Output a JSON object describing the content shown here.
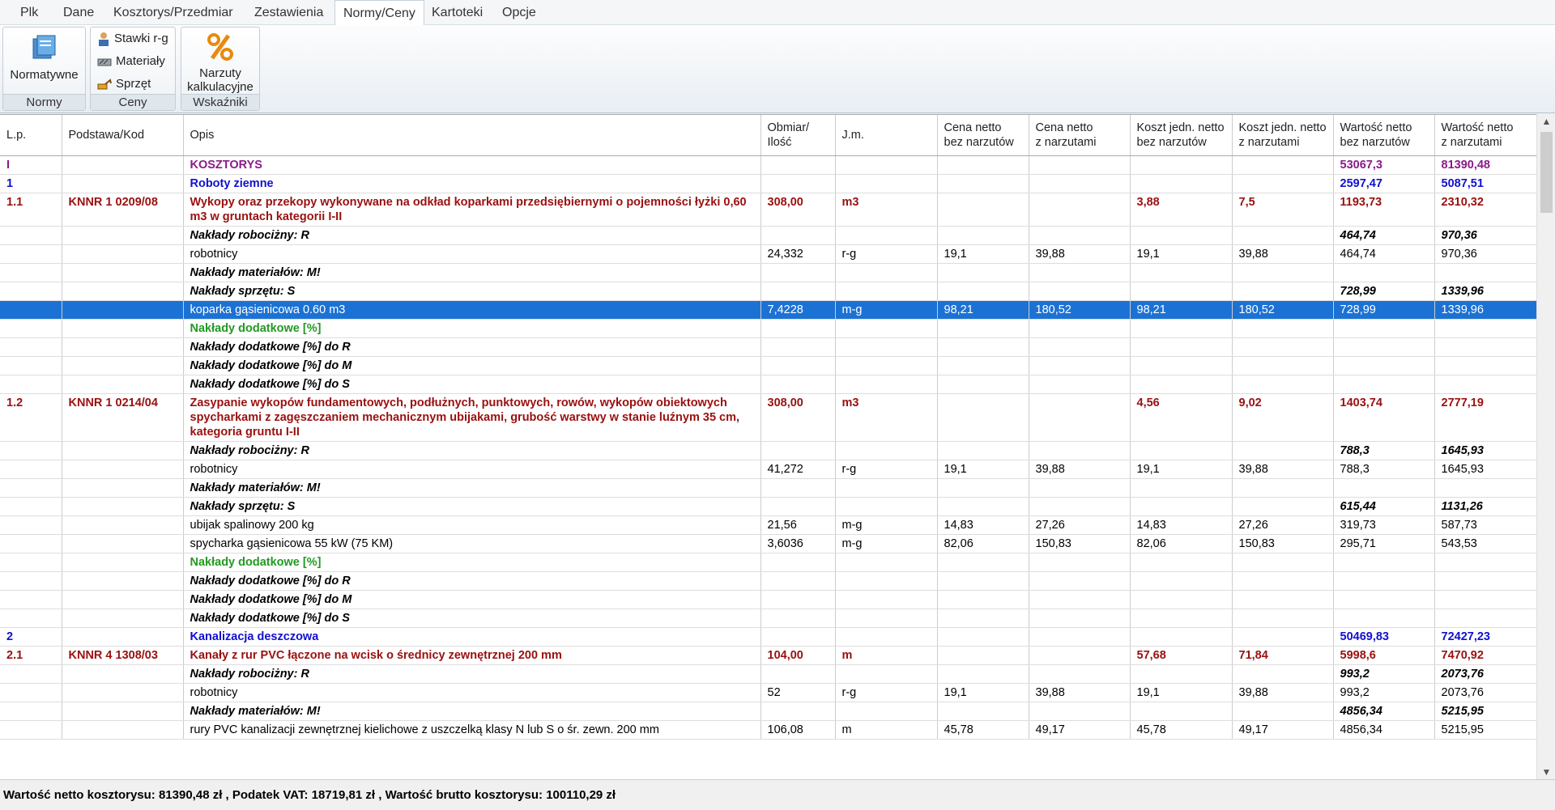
{
  "menu": [
    "Plk",
    "Dane",
    "Kosztorys/Przedmiar",
    "Zestawienia",
    "Normy/Ceny",
    "Kartoteki",
    "Opcje"
  ],
  "ribbon": {
    "normy": {
      "button": "Normatywne",
      "label": "Normy"
    },
    "ceny": {
      "items": [
        "Stawki r-g",
        "Materiały",
        "Sprzęt"
      ],
      "label": "Ceny"
    },
    "wskazniki": {
      "button_line1": "Narzuty",
      "button_line2": "kalkulacyjne",
      "label": "Wskaźniki"
    }
  },
  "columns": [
    "L.p.",
    "Podstawa/Kod",
    "Opis",
    "Obmiar/\nIlość",
    "J.m.",
    "Cena netto\nbez narzutów",
    "Cena netto\nz narzutami",
    "Koszt jedn. netto\nbez narzutów",
    "Koszt jedn. netto\nz narzutami",
    "Wartość netto\nbez narzutów",
    "Wartość netto\nz narzutami"
  ],
  "rows": [
    {
      "t": "kosztorys",
      "c": [
        "I",
        "",
        "KOSZTORYS",
        "",
        "",
        "",
        "",
        "",
        "",
        "53067,3",
        "81390,48"
      ]
    },
    {
      "t": "dzial",
      "c": [
        "1",
        "",
        "Roboty ziemne",
        "",
        "",
        "",
        "",
        "",
        "",
        "2597,47",
        "5087,51"
      ]
    },
    {
      "t": "pos",
      "c": [
        "1.1",
        "KNNR 1 0209/08",
        "Wykopy oraz przekopy wykonywane na odkład koparkami przedsiębiernymi o pojemności łyżki 0,60 m3 w gruntach kategorii I-II",
        "308,00",
        "m3",
        "",
        "",
        "3,88",
        "7,5",
        "1193,73",
        "2310,32"
      ]
    },
    {
      "t": "nak",
      "c": [
        "",
        "",
        "Nakłady robociżny: R",
        "",
        "",
        "",
        "",
        "",
        "",
        "464,74",
        "970,36"
      ]
    },
    {
      "t": "norm",
      "c": [
        "",
        "",
        "robotnicy",
        "24,332",
        "r-g",
        "19,1",
        "39,88",
        "19,1",
        "39,88",
        "464,74",
        "970,36"
      ]
    },
    {
      "t": "nak",
      "c": [
        "",
        "",
        "Nakłady materiałów: M!",
        "",
        "",
        "",
        "",
        "",
        "",
        "",
        ""
      ]
    },
    {
      "t": "nak",
      "c": [
        "",
        "",
        "Nakłady sprzętu: S",
        "",
        "",
        "",
        "",
        "",
        "",
        "728,99",
        "1339,96"
      ]
    },
    {
      "t": "sel",
      "c": [
        "",
        "",
        "koparka gąsienicowa 0.60 m3",
        "7,4228",
        "m-g",
        "98,21",
        "180,52",
        "98,21",
        "180,52",
        "728,99",
        "1339,96"
      ]
    },
    {
      "t": "green",
      "c": [
        "",
        "",
        "Nakłady dodatkowe [%]",
        "",
        "",
        "",
        "",
        "",
        "",
        "",
        ""
      ]
    },
    {
      "t": "dod",
      "c": [
        "",
        "",
        "Nakłady dodatkowe [%] do R",
        "",
        "",
        "",
        "",
        "",
        "",
        "",
        ""
      ]
    },
    {
      "t": "dod",
      "c": [
        "",
        "",
        "Nakłady dodatkowe [%] do M",
        "",
        "",
        "",
        "",
        "",
        "",
        "",
        ""
      ]
    },
    {
      "t": "dod",
      "c": [
        "",
        "",
        "Nakłady dodatkowe [%] do S",
        "",
        "",
        "",
        "",
        "",
        "",
        "",
        ""
      ]
    },
    {
      "t": "pos",
      "c": [
        "1.2",
        "KNNR 1 0214/04",
        "Zasypanie wykopów fundamentowych, podłużnych, punktowych, rowów, wykopów obiektowych spycharkami z zagęszczaniem mechanicznym ubijakami, grubość warstwy w stanie luźnym 35 cm, kategoria gruntu I-II",
        "308,00",
        "m3",
        "",
        "",
        "4,56",
        "9,02",
        "1403,74",
        "2777,19"
      ]
    },
    {
      "t": "nak",
      "c": [
        "",
        "",
        "Nakłady robociżny: R",
        "",
        "",
        "",
        "",
        "",
        "",
        "788,3",
        "1645,93"
      ]
    },
    {
      "t": "norm",
      "c": [
        "",
        "",
        "robotnicy",
        "41,272",
        "r-g",
        "19,1",
        "39,88",
        "19,1",
        "39,88",
        "788,3",
        "1645,93"
      ]
    },
    {
      "t": "nak",
      "c": [
        "",
        "",
        "Nakłady materiałów: M!",
        "",
        "",
        "",
        "",
        "",
        "",
        "",
        ""
      ]
    },
    {
      "t": "nak",
      "c": [
        "",
        "",
        "Nakłady sprzętu: S",
        "",
        "",
        "",
        "",
        "",
        "",
        "615,44",
        "1131,26"
      ]
    },
    {
      "t": "norm",
      "c": [
        "",
        "",
        "ubijak spalinowy 200 kg",
        "21,56",
        "m-g",
        "14,83",
        "27,26",
        "14,83",
        "27,26",
        "319,73",
        "587,73"
      ]
    },
    {
      "t": "norm",
      "c": [
        "",
        "",
        "spycharka gąsienicowa 55 kW (75 KM)",
        "3,6036",
        "m-g",
        "82,06",
        "150,83",
        "82,06",
        "150,83",
        "295,71",
        "543,53"
      ]
    },
    {
      "t": "green",
      "c": [
        "",
        "",
        "Nakłady dodatkowe [%]",
        "",
        "",
        "",
        "",
        "",
        "",
        "",
        ""
      ]
    },
    {
      "t": "dod",
      "c": [
        "",
        "",
        "Nakłady dodatkowe [%] do R",
        "",
        "",
        "",
        "",
        "",
        "",
        "",
        ""
      ]
    },
    {
      "t": "dod",
      "c": [
        "",
        "",
        "Nakłady dodatkowe [%] do M",
        "",
        "",
        "",
        "",
        "",
        "",
        "",
        ""
      ]
    },
    {
      "t": "dod",
      "c": [
        "",
        "",
        "Nakłady dodatkowe [%] do S",
        "",
        "",
        "",
        "",
        "",
        "",
        "",
        ""
      ]
    },
    {
      "t": "dzial",
      "c": [
        "2",
        "",
        "Kanalizacja deszczowa",
        "",
        "",
        "",
        "",
        "",
        "",
        "50469,83",
        "72427,23"
      ]
    },
    {
      "t": "pos",
      "c": [
        "2.1",
        "KNNR 4 1308/03",
        "Kanały z rur PVC łączone na wcisk o średnicy zewnętrznej 200 mm",
        "104,00",
        "m",
        "",
        "",
        "57,68",
        "71,84",
        "5998,6",
        "7470,92"
      ]
    },
    {
      "t": "nak",
      "c": [
        "",
        "",
        "Nakłady robociżny: R",
        "",
        "",
        "",
        "",
        "",
        "",
        "993,2",
        "2073,76"
      ]
    },
    {
      "t": "norm",
      "c": [
        "",
        "",
        "robotnicy",
        "52",
        "r-g",
        "19,1",
        "39,88",
        "19,1",
        "39,88",
        "993,2",
        "2073,76"
      ]
    },
    {
      "t": "nak",
      "c": [
        "",
        "",
        "Nakłady materiałów: M!",
        "",
        "",
        "",
        "",
        "",
        "",
        "4856,34",
        "5215,95"
      ]
    },
    {
      "t": "norm",
      "c": [
        "",
        "",
        "rury PVC kanalizacji zewnętrznej kielichowe z uszczelką klasy N lub S o śr. zewn. 200 mm",
        "106,08",
        "m",
        "45,78",
        "49,17",
        "45,78",
        "49,17",
        "4856,34",
        "5215,95"
      ]
    }
  ],
  "status": "Wartość netto kosztorysu:  81390,48 zł , Podatek VAT:  18719,81 zł  , Wartość brutto kosztorysu:  100110,29 zł"
}
